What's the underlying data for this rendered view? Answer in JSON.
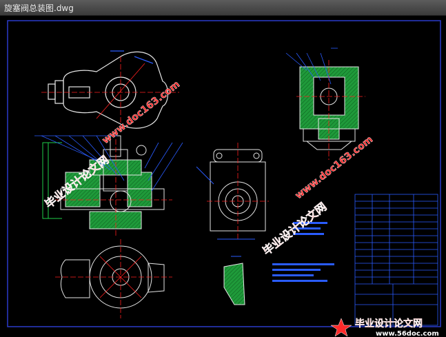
{
  "window": {
    "title": "旋塞阀总装图.dwg"
  },
  "watermarks": {
    "cn_text": "毕业设计论文网",
    "url_text": "www.doc163.com",
    "footer_cn": "毕业设计论文网",
    "footer_url": "www.56doc.com"
  },
  "colors": {
    "background": "#000000",
    "frame": "#2a3acb",
    "hatch_green": "#1f9a3a",
    "outline_white": "#e6e6e6",
    "center_red": "#ff2020",
    "text_blue": "#2a5cff",
    "watermark_red": "#ff2a2a"
  }
}
